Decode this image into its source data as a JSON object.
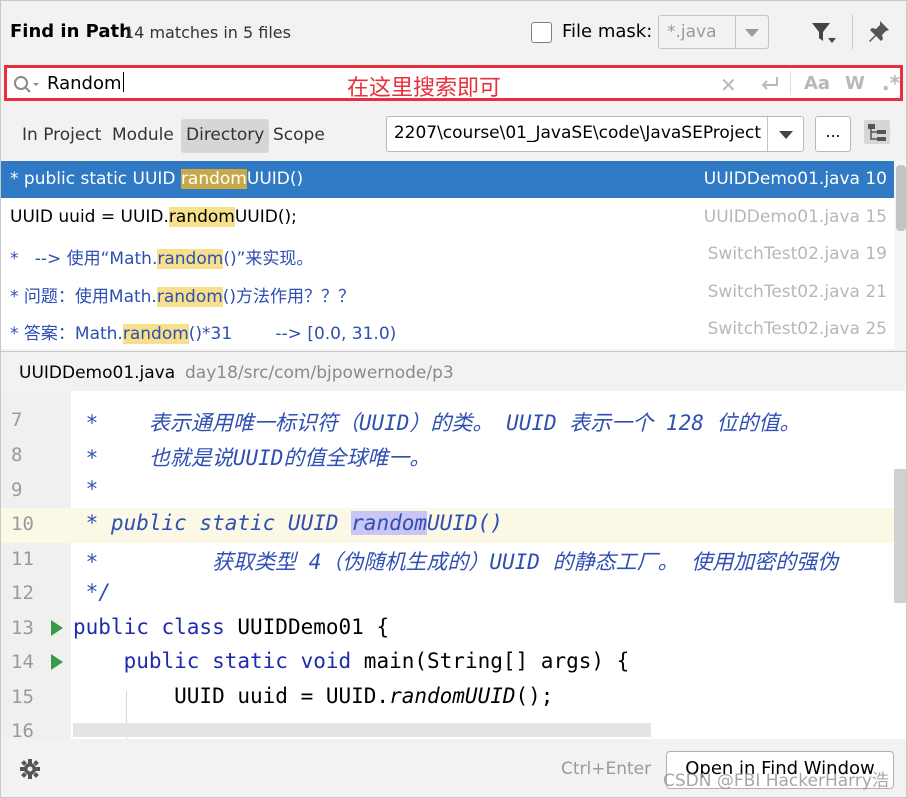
{
  "header": {
    "title": "Find in Path",
    "matches": "14 matches in 5 files",
    "file_mask_label": "File mask:",
    "file_mask_value": "*.java"
  },
  "search": {
    "query": "Random",
    "annotation": "在这里搜索即可",
    "match_case": "Aa",
    "words": "W",
    "regex": ".*"
  },
  "scope": {
    "tabs": [
      {
        "label": "In Project"
      },
      {
        "label": "Module"
      },
      {
        "label": "Directory"
      },
      {
        "label": "Scope"
      }
    ],
    "active_tab": "Directory",
    "directory": "2207\\course\\01_JavaSE\\code\\JavaSEProject",
    "browse_label": "..."
  },
  "results": [
    {
      "prefix": "* public static UUID ",
      "match": "random",
      "suffix": "UUID()",
      "file": "UUIDDemo01.java 10",
      "selected": true,
      "comment": false
    },
    {
      "prefix": "UUID uuid = UUID.",
      "match": "random",
      "suffix": "UUID();",
      "file": "UUIDDemo01.java 15",
      "selected": false,
      "comment": false
    },
    {
      "prefix": "*   --> 使用“Math.",
      "match": "random",
      "suffix": "()”来实现。",
      "file": "SwitchTest02.java 19",
      "selected": false,
      "comment": true
    },
    {
      "prefix": "* 问题：使用Math.",
      "match": "random",
      "suffix": "()方法作用？？？",
      "file": "SwitchTest02.java 21",
      "selected": false,
      "comment": true
    },
    {
      "prefix": "* 答案：Math.",
      "match": "random",
      "suffix": "()*31        --> [0.0, 31.0)",
      "file": "SwitchTest02.java 25",
      "selected": false,
      "comment": true
    }
  ],
  "preview": {
    "file": "UUIDDemo01.java",
    "path": "day18/src/com/bjpowernode/p3"
  },
  "editor": {
    "lines": [
      {
        "num": "7",
        "text": " *    表示通用唯一标识符（UUID）的类。 UUID 表示一个 128 位的值。"
      },
      {
        "num": "8",
        "text": " *    也就是说UUID的值全球唯一。"
      },
      {
        "num": "9",
        "text": " *"
      },
      {
        "num": "10",
        "pre": " * public static UUID ",
        "occ": "random",
        "post": "UUID()"
      },
      {
        "num": "11",
        "text": " *         获取类型 4（伪随机生成的）UUID 的静态工厂。 使用加密的强伪"
      },
      {
        "num": "12",
        "text": " */"
      },
      {
        "num": "13",
        "kw": "public class ",
        "rest": "UUIDDemo01 {"
      },
      {
        "num": "14",
        "indent": "    ",
        "kw": "public static void ",
        "rest": "main(String[] args) {"
      },
      {
        "num": "15",
        "a": "        UUID uuid = UUID.",
        "it": "randomUUID",
        "b": "();"
      },
      {
        "num": "16",
        "text": ""
      }
    ]
  },
  "footer": {
    "shortcut": "Ctrl+Enter",
    "open_button": "Open in Find Window",
    "watermark": "CSDN @FBI HackerHarry浩"
  },
  "colors": {
    "selection": "#2f79c5",
    "match_highlight": "#f6e08c",
    "annotation_red": "#e8303c",
    "comment_blue": "#2f4fb2",
    "keyword_blue": "#1e2bb0"
  }
}
